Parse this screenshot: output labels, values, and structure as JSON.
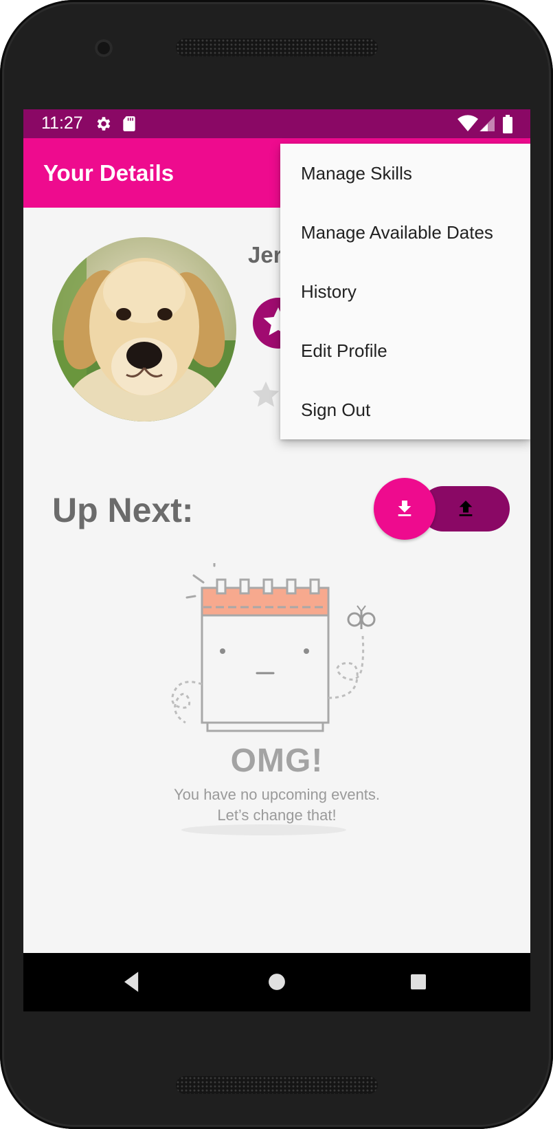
{
  "status_bar": {
    "time": "11:27",
    "icons": [
      "settings-icon",
      "sd-card-icon",
      "wifi-icon",
      "signal-icon",
      "battery-icon"
    ]
  },
  "app_bar": {
    "title": "Your Details"
  },
  "profile": {
    "name": "Jer",
    "avatar": "dog-photo"
  },
  "up_next": {
    "label": "Up Next:"
  },
  "toggle": {
    "left_icon": "download-icon",
    "right_icon": "upload-icon",
    "selected": "download"
  },
  "empty_state": {
    "heading": "OMG!",
    "line1": "You have no upcoming events.",
    "line2": "Let’s change that!"
  },
  "overflow_menu": {
    "items": [
      {
        "label": "Manage Skills"
      },
      {
        "label": "Manage Available Dates"
      },
      {
        "label": "History"
      },
      {
        "label": "Edit Profile"
      },
      {
        "label": "Sign Out"
      }
    ]
  },
  "nav_bar": {
    "buttons": [
      "back-icon",
      "home-icon",
      "recents-icon"
    ]
  },
  "colors": {
    "primary": "#ee0b8e",
    "primary_dark": "#8a0865",
    "accent_dark": "#a00b70",
    "background": "#f5f5f5",
    "illustration_accent": "#f7a98e"
  }
}
